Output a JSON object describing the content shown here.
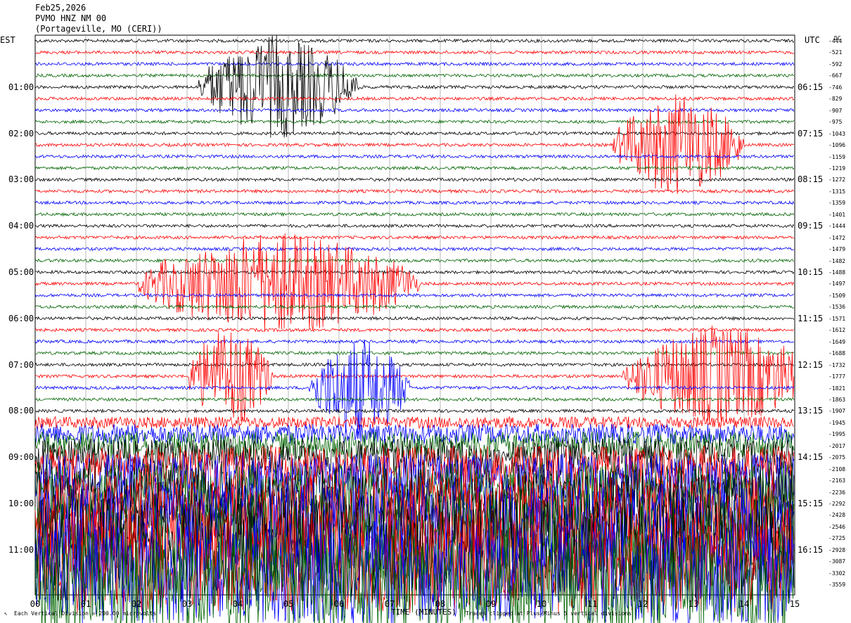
{
  "header": {
    "date": "Feb25,2026",
    "station": "PVMO HNZ NM 00",
    "location": "(Portageville, MO (CERI))"
  },
  "left_axis_label": "EST",
  "right_axis_label": "UTC",
  "dc_label": "DC",
  "footer": {
    "scale_note": "Each Vertical Division = 200.00 microvolts",
    "xlabel": "TIME (MINUTES)",
    "clip_note": "Traces clipped at Plus/Minus 5 vertical divisions"
  },
  "colors": {
    "trace_cycle": [
      "#000000",
      "#ff0000",
      "#0000ff",
      "#006400"
    ],
    "grid": "#888888"
  },
  "chart_data": {
    "type": "line",
    "title": "PVMO HNZ NM 00",
    "xlabel": "TIME (MINUTES)",
    "ylabel": "",
    "xlim": [
      0,
      15
    ],
    "x_ticks": [
      "00",
      "01",
      "02",
      "03",
      "04",
      "05",
      "06",
      "07",
      "08",
      "09",
      "10",
      "11",
      "12",
      "13",
      "14",
      "15"
    ],
    "trace_count": 48,
    "minutes_per_trace": 15,
    "left_hour_labels": [
      "01:00",
      "02:00",
      "03:00",
      "04:00",
      "05:00",
      "06:00",
      "07:00",
      "08:00",
      "09:00",
      "10:00",
      "11:00"
    ],
    "right_hour_labels": [
      "06:15",
      "07:15",
      "08:15",
      "09:15",
      "10:15",
      "11:15",
      "12:15",
      "13:15",
      "14:15",
      "15:15",
      "16:15"
    ],
    "dc_offsets": [
      -444,
      -521,
      -592,
      -667,
      -746,
      -829,
      -907,
      -975,
      -1043,
      -1096,
      -1159,
      -1219,
      -1272,
      -1315,
      -1359,
      -1401,
      -1444,
      -1472,
      -1479,
      -1482,
      -1488,
      -1497,
      -1509,
      -1536,
      -1571,
      -1612,
      -1649,
      -1688,
      -1732,
      -1777,
      -1821,
      -1863,
      -1907,
      -1945,
      -1995,
      -2017,
      -2075,
      -2108,
      -2163,
      -2236,
      -2292,
      -2428,
      -2546,
      -2725,
      -2928,
      -3087,
      -3302,
      -3559
    ],
    "events": [
      {
        "trace": 4,
        "start_min": 3.6,
        "end_min": 6.0,
        "amplitude": 5
      },
      {
        "trace": 9,
        "start_min": 11.8,
        "end_min": 13.6,
        "amplitude": 5
      },
      {
        "trace": 21,
        "start_min": 2.4,
        "end_min": 7.2,
        "amplitude": 5
      },
      {
        "trace": 29,
        "start_min": 3.4,
        "end_min": 4.3,
        "amplitude": 5
      },
      {
        "trace": 30,
        "start_min": 5.8,
        "end_min": 7.0,
        "amplitude": 5
      },
      {
        "trace": 29,
        "start_min": 12.0,
        "end_min": 15.0,
        "amplitude": 5
      }
    ]
  }
}
